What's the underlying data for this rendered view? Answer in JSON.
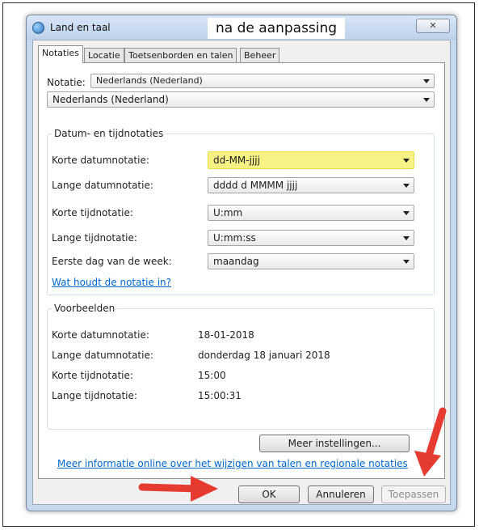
{
  "overlay": {
    "caption": "na de aanpassing",
    "arrow_color": "#e63b30",
    "highlight_color": "#f6f285"
  },
  "window": {
    "title": "Land en taal",
    "close_label": "✕"
  },
  "tabs": [
    {
      "label": "Notaties"
    },
    {
      "label": "Locatie"
    },
    {
      "label": "Toetsenborden en talen"
    },
    {
      "label": "Beheer"
    }
  ],
  "notatie": {
    "label": "Notatie:",
    "select_value": "Nederlands (Nederland)",
    "second_value": "Nederlands (Nederland)"
  },
  "formats": {
    "group_title": "Datum- en tijdnotaties",
    "rows": [
      {
        "label": "Korte datumnotatie:",
        "value": "dd-MM-jjjj"
      },
      {
        "label": "Lange datumnotatie:",
        "value": "dddd d MMMM jjjj"
      },
      {
        "label": "Korte tijdnotatie:",
        "value": "U:mm"
      },
      {
        "label": "Lange tijdnotatie:",
        "value": "U:mm:ss"
      },
      {
        "label": "Eerste dag van de week:",
        "value": "maandag"
      }
    ],
    "help_link": "Wat houdt de notatie in?"
  },
  "examples": {
    "group_title": "Voorbeelden",
    "rows": [
      {
        "label": "Korte datumnotatie:",
        "value": "18-01-2018"
      },
      {
        "label": "Lange datumnotatie:",
        "value": "donderdag 18 januari 2018"
      },
      {
        "label": "Korte tijdnotatie:",
        "value": "15:00"
      },
      {
        "label": "Lange tijdnotatie:",
        "value": "15:00:31"
      }
    ]
  },
  "more_settings_button": "Meer instellingen...",
  "info_link": "Meer informatie online over het wijzigen van talen en regionale notaties",
  "buttons": {
    "ok": "OK",
    "cancel": "Annuleren",
    "apply": "Toepassen"
  }
}
